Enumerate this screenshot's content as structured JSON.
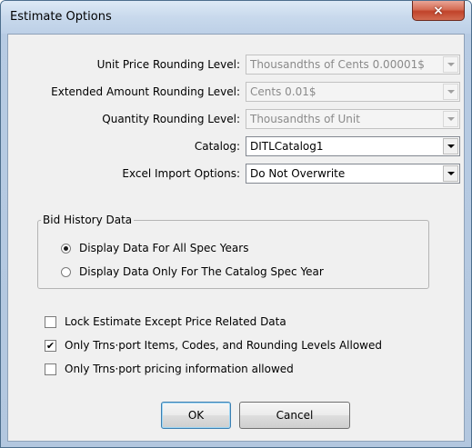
{
  "window": {
    "title": "Estimate Options",
    "close_icon": "×"
  },
  "fields": {
    "unit_price": {
      "label": "Unit Price Rounding Level:",
      "value": "Thousandths of Cents 0.00001$",
      "enabled": false
    },
    "extended_amount": {
      "label": "Extended Amount Rounding Level:",
      "value": "Cents 0.01$",
      "enabled": false
    },
    "quantity": {
      "label": "Quantity Rounding Level:",
      "value": "Thousandths of Unit",
      "enabled": false
    },
    "catalog": {
      "label": "Catalog:",
      "value": "DITLCatalog1",
      "enabled": true
    },
    "excel_import": {
      "label": "Excel Import Options:",
      "value": "Do Not Overwrite",
      "enabled": true
    }
  },
  "bid_history": {
    "legend": "Bid History Data",
    "options": [
      {
        "label": "Display Data For All Spec Years",
        "selected": true
      },
      {
        "label": "Display Data Only For The Catalog Spec Year",
        "selected": false
      }
    ]
  },
  "checkboxes": [
    {
      "label": "Lock Estimate Except Price Related Data",
      "checked": false
    },
    {
      "label": "Only Trns·port Items, Codes, and Rounding Levels Allowed",
      "checked": true
    },
    {
      "label": "Only Trns·port pricing information allowed",
      "checked": false
    }
  ],
  "buttons": {
    "ok_label": "OK",
    "cancel_label": "Cancel"
  },
  "colors": {
    "title_bar": "#c8d9ec",
    "close_button": "#c0432a",
    "dialog_background": "#f0f0f0",
    "default_button_border": "#3c7fb1"
  },
  "icons": {
    "close": "close-icon",
    "dropdown_arrow": "chevron-down-icon",
    "check": "check-icon"
  }
}
